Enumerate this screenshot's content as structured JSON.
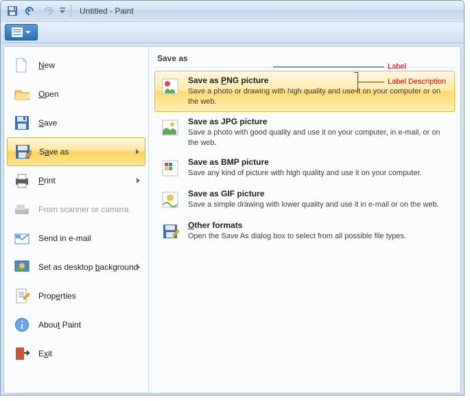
{
  "window": {
    "title": "Untitled - Paint"
  },
  "menu": {
    "items": [
      {
        "label": "New",
        "accel": "N"
      },
      {
        "label": "Open",
        "accel": "O"
      },
      {
        "label": "Save",
        "accel": "S"
      },
      {
        "label": "Save as",
        "accel": "a",
        "submenu": true,
        "hovered": true
      },
      {
        "label": "Print",
        "accel": "P",
        "submenu": true
      },
      {
        "label": "From scanner or camera",
        "disabled": true
      },
      {
        "label": "Send in e-mail"
      },
      {
        "label": "Set as desktop background",
        "accel": "b",
        "submenu": true
      },
      {
        "label": "Properties",
        "accel": "e"
      },
      {
        "label": "About Paint",
        "accel": "t"
      },
      {
        "label": "Exit",
        "accel": "x"
      }
    ]
  },
  "saveas": {
    "header": "Save as",
    "options": [
      {
        "title": "Save as PNG picture",
        "accel": "P",
        "desc": "Save a photo or drawing with high quality and use it on your computer or on the web.",
        "highlight": true
      },
      {
        "title": "Save as JPG picture",
        "desc": "Save a photo with good quality and use it on your computer, in e-mail, or on the web."
      },
      {
        "title": "Save as BMP picture",
        "desc": "Save any kind of picture with high quality and use it on your computer."
      },
      {
        "title": "Save as GIF picture",
        "desc": "Save a simple drawing with lower quality and use it in e-mail or on the web."
      },
      {
        "title": "Other formats",
        "accel": "O",
        "desc": "Open the Save As dialog box to select from all possible file types."
      }
    ]
  },
  "annotations": {
    "label": "Label",
    "label_desc": "Label Description"
  }
}
